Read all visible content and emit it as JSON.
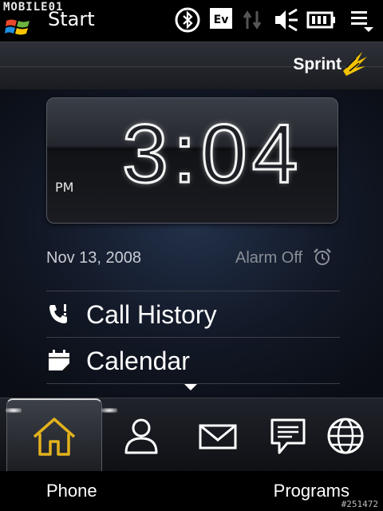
{
  "status_bar": {
    "watermark": "MOBILE01",
    "title": "Start",
    "network_badge": "Ev",
    "icons": [
      "windows-flag-icon",
      "bluetooth-icon",
      "ev-network-icon",
      "data-sync-icon",
      "volume-icon",
      "battery-icon",
      "menu-dropdown-icon"
    ]
  },
  "header": {
    "carrier": "Sprint"
  },
  "clock": {
    "time": "3:04",
    "ampm": "PM"
  },
  "date": "Nov 13, 2008",
  "alarm": {
    "label": "Alarm Off",
    "icon": "alarm-clock-icon"
  },
  "menu": {
    "items": [
      {
        "label": "Call History",
        "icon": "call-history-icon"
      },
      {
        "label": "Calendar",
        "icon": "calendar-icon"
      }
    ]
  },
  "tabs": [
    {
      "icon": "home-icon",
      "active": true
    },
    {
      "icon": "contact-icon",
      "active": false
    },
    {
      "icon": "mail-icon",
      "active": false
    },
    {
      "icon": "message-icon",
      "active": false
    },
    {
      "icon": "globe-icon",
      "active": false
    }
  ],
  "softkeys": {
    "left": "Phone",
    "right": "Programs"
  },
  "reference": "#251472",
  "colors": {
    "active_tab_accent": "#e3b21c",
    "accent_yellow": "#f2c200"
  }
}
